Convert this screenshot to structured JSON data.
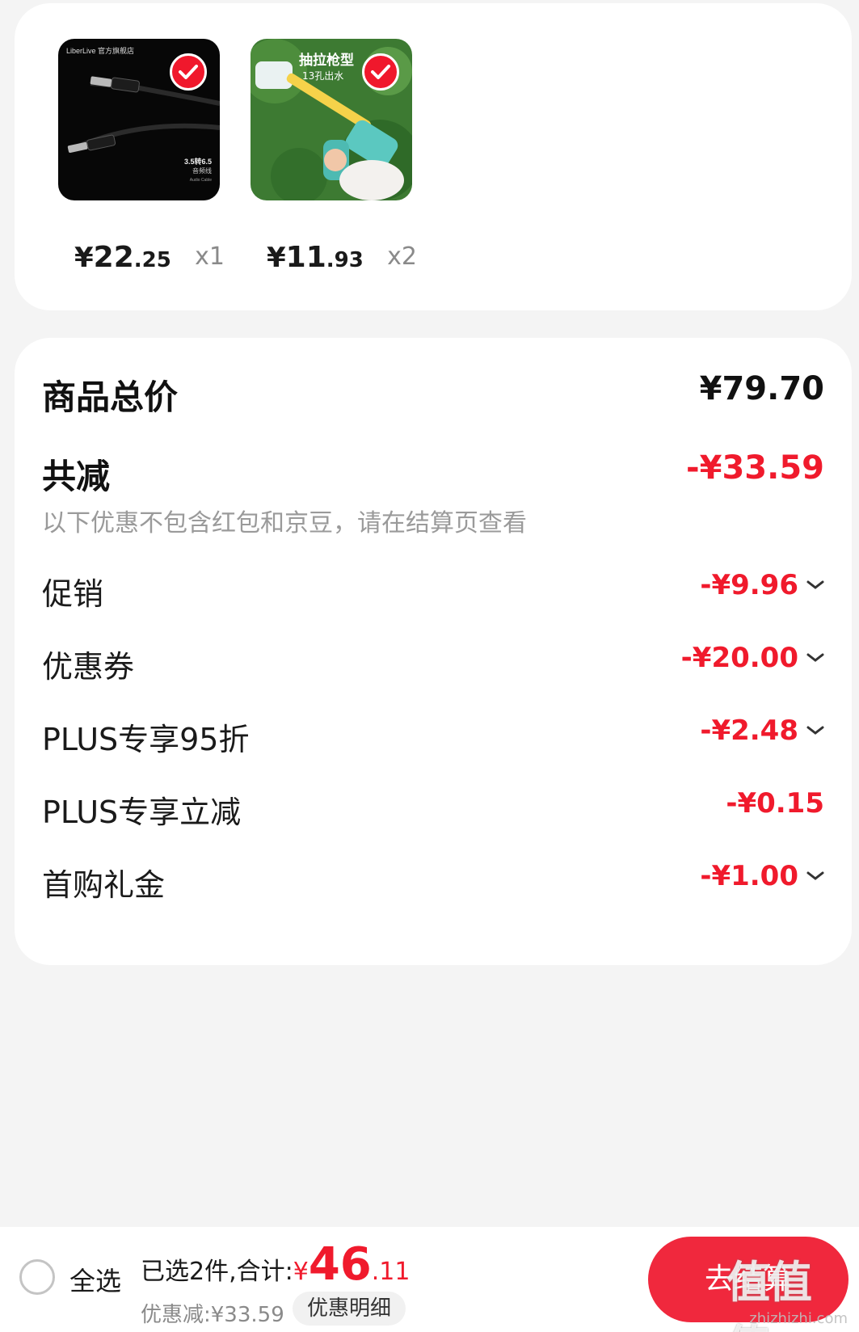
{
  "products": [
    {
      "price_symbol": "¥",
      "price_int": "22",
      "price_dec": ".25",
      "quantity": "x1",
      "selected": true,
      "image_text": {
        "brand": "LiberLive 官方旗舰店",
        "spec": "3.5转6.5",
        "spec_sub": "音频线",
        "caption": "Audio Cable"
      }
    },
    {
      "price_symbol": "¥",
      "price_int": "11",
      "price_dec": ".93",
      "quantity": "x2",
      "selected": true,
      "image_text": {
        "line1": "抽拉枪型",
        "line2": "13孔出水"
      }
    }
  ],
  "summary": {
    "total_label": "商品总价",
    "total_value": "¥79.70",
    "reduce_label": "共减",
    "reduce_value": "-¥33.59",
    "note": "以下优惠不包含红包和京豆，请在结算页查看",
    "items": [
      {
        "label": "促销",
        "value": "-¥9.96",
        "expandable": true
      },
      {
        "label": "优惠券",
        "value": "-¥20.00",
        "expandable": true
      },
      {
        "label": "PLUS专享95折",
        "value": "-¥2.48",
        "expandable": true
      },
      {
        "label": "PLUS专享立减",
        "value": "-¥0.15",
        "expandable": false
      },
      {
        "label": "首购礼金",
        "value": "-¥1.00",
        "expandable": true
      }
    ]
  },
  "bottom_bar": {
    "select_all_label": "全选",
    "selected_summary": "已选2件,合计:",
    "total_symbol": "¥",
    "total_int": "46",
    "total_dec": ".11",
    "discount_text": "优惠减:¥33.59",
    "detail_button": "优惠明细",
    "checkout_button": "去结算"
  },
  "watermark": {
    "logo": "值值值",
    "url": "zhizhizhi.com"
  },
  "colors": {
    "accent_red": "#f01a2c",
    "background": "#f4f4f4",
    "card": "#ffffff"
  }
}
